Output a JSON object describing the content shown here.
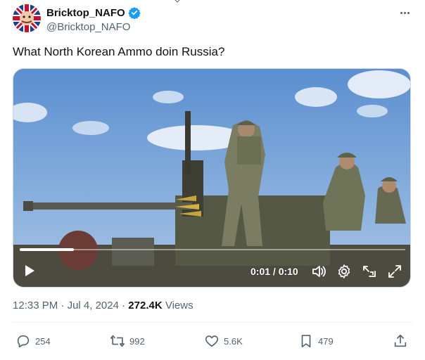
{
  "post": {
    "author": {
      "display_name": "Bricktop_NAFO",
      "handle": "@Bricktop_NAFO",
      "verified": true
    },
    "text": "What North Korean Ammo doin Russia?",
    "video": {
      "time_readout": "0:01 / 0:10",
      "progress_fraction": 0.14
    },
    "meta": {
      "time": "12:33 PM",
      "separator": " · ",
      "date": "Jul 4, 2024",
      "separator2": " · ",
      "views_count": "272.4K",
      "views_label": " Views"
    },
    "actions": {
      "replies": "254",
      "reposts": "992",
      "likes": "5.6K",
      "bookmarks": "479"
    }
  },
  "colors": {
    "verified": "#1d9bf0",
    "muted_text": "#536471",
    "primary_text": "#0f1419"
  },
  "icons": [
    "verified-badge-icon",
    "more-icon",
    "play-icon",
    "volume-icon",
    "settings-gear-icon",
    "minimize-player-icon",
    "fullscreen-icon",
    "reply-icon",
    "repost-icon",
    "like-icon",
    "bookmark-icon",
    "share-icon"
  ]
}
